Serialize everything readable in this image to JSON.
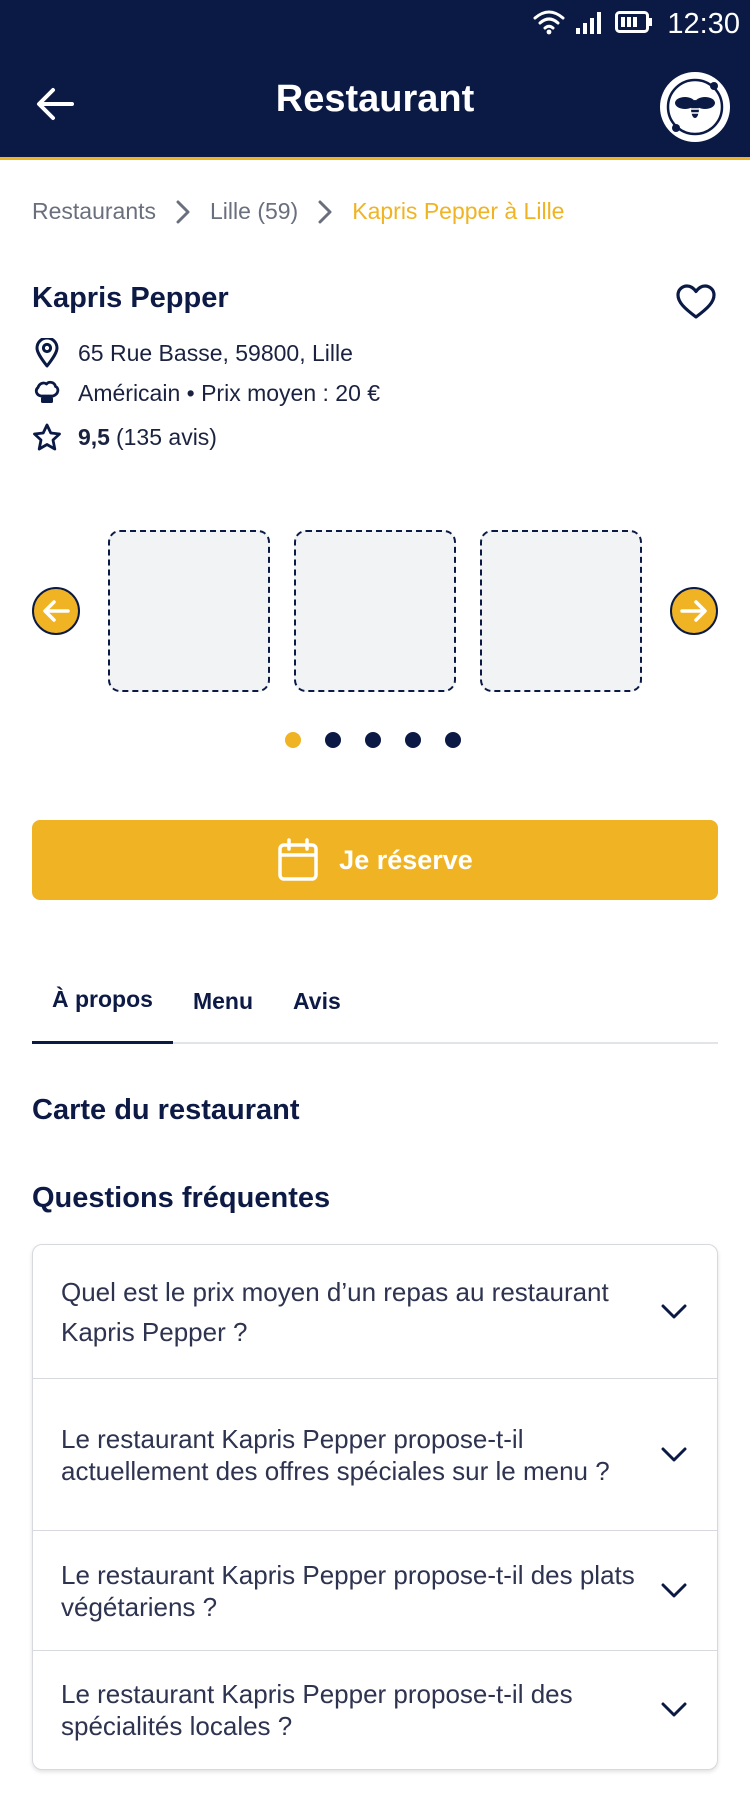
{
  "status_bar": {
    "time": "12:30"
  },
  "app_bar": {
    "title": "Restaurant"
  },
  "breadcrumb": [
    {
      "label": "Restaurants"
    },
    {
      "label": "Lille (59)"
    },
    {
      "label": "Kapris Pepper à Lille"
    }
  ],
  "restaurant": {
    "name": "Kapris Pepper",
    "address": "65 Rue Basse, 59800, Lille",
    "cuisine_price": "Américain • Prix moyen : 20 €",
    "rating": "9,5",
    "reviews": "(135 avis)"
  },
  "gallery": {
    "total_dots": 5,
    "active_dot": 1
  },
  "cta": {
    "label": "Je réserve"
  },
  "tabs": [
    {
      "label": "À propos",
      "active": true
    },
    {
      "label": "Menu",
      "active": false
    },
    {
      "label": "Avis",
      "active": false
    }
  ],
  "sections": {
    "menu_card_title": "Carte du restaurant",
    "faq_title": "Questions fréquentes"
  },
  "faq": [
    "Quel est le prix moyen d’un repas au restaurant Kapris Pepper ?",
    "Le restaurant Kapris Pepper propose-t-il actuellement des offres spéciales sur le menu ?",
    "Le restaurant Kapris Pepper propose-t-il des plats végétariens ?",
    "Le restaurant Kapris Pepper propose-t-il des spécialités locales ?"
  ],
  "colors": {
    "navy": "#0b1a45",
    "accent": "#f0b323",
    "muted": "#6a6f7d"
  }
}
